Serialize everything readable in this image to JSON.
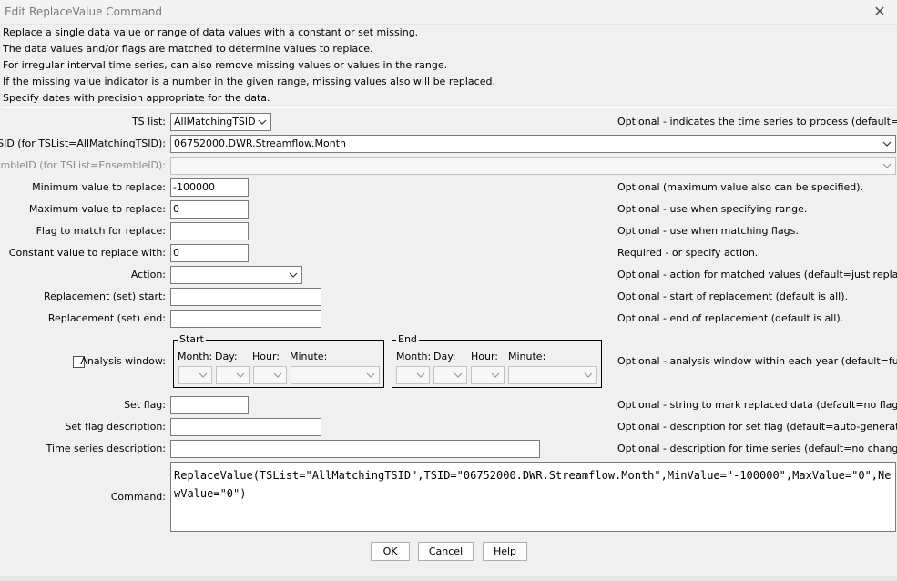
{
  "window": {
    "title": "Edit ReplaceValue Command"
  },
  "description": [
    "Replace a single data value or range of data values with a constant or set missing.",
    "The data values and/or flags are matched to determine values to replace.",
    "For irregular interval time series, can also remove missing values or values in the range.",
    "If the missing value indicator is a number in the given range, missing values also will be replaced.",
    "Specify dates with precision appropriate for the data."
  ],
  "form": {
    "ts_list": {
      "label": "TS list:",
      "value": "AllMatchingTSID",
      "note": "Optional - indicates the time series to process (default=AllTS)."
    },
    "tsid": {
      "label": "TSID (for TSList=AllMatchingTSID):",
      "value": "06752000.DWR.Streamflow.Month"
    },
    "ensemble_id": {
      "label": "EnsembleID (for TSList=EnsembleID):",
      "value": ""
    },
    "min_value": {
      "label": "Minimum value to replace:",
      "value": "-100000",
      "note": "Optional (maximum value also can be specified)."
    },
    "max_value": {
      "label": "Maximum value to replace:",
      "value": "0",
      "note": "Optional - use when specifying range."
    },
    "match_flag": {
      "label": "Flag to match for replace:",
      "value": "",
      "note": "Optional - use when matching flags."
    },
    "new_value": {
      "label": "Constant value to replace with:",
      "value": "0",
      "note": "Required - or specify action."
    },
    "action": {
      "label": "Action:",
      "value": "",
      "note": "Optional - action for matched values (default=just replace)."
    },
    "set_start": {
      "label": "Replacement (set) start:",
      "value": "",
      "note": "Optional - start of replacement (default is all)."
    },
    "set_end": {
      "label": "Replacement (set) end:",
      "value": "",
      "note": "Optional - end of replacement (default is all)."
    },
    "analysis_window": {
      "label": "Analysis window:",
      "checked": false,
      "note": "Optional - analysis window within each year (default=full year).",
      "start_title": "Start",
      "end_title": "End",
      "month_label": "Month:",
      "day_label": "Day:",
      "hour_label": "Hour:",
      "minute_label": "Minute:"
    },
    "set_flag": {
      "label": "Set flag:",
      "value": "",
      "note": "Optional - string to mark replaced data (default=no flag)."
    },
    "set_flag_desc": {
      "label": "Set flag description:",
      "value": "",
      "note": "Optional - description for set flag (default=auto-generated)."
    },
    "ts_desc": {
      "label": "Time series description:",
      "value": "",
      "note": "Optional - description for time series (default=no change)."
    },
    "command": {
      "label": "Command:",
      "value": "ReplaceValue(TSList=\"AllMatchingTSID\",TSID=\"06752000.DWR.Streamflow.Month\",MinValue=\"-100000\",MaxValue=\"0\",NewValue=\"0\")"
    }
  },
  "buttons": {
    "ok": "OK",
    "cancel": "Cancel",
    "help": "Help"
  }
}
